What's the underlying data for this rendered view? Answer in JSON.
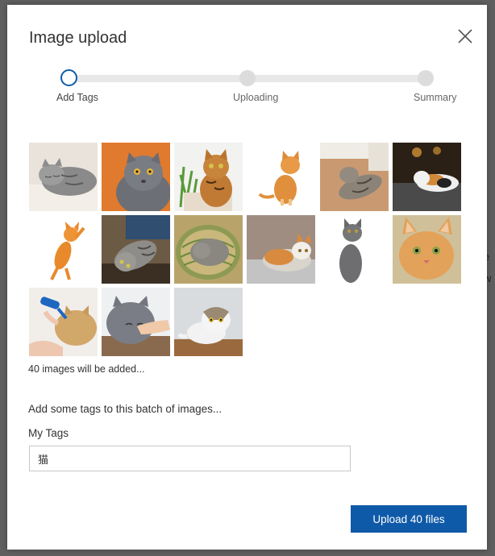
{
  "background_peek": {
    "line1": "e",
    "line2": "w"
  },
  "dialog": {
    "title": "Image upload",
    "steps": [
      {
        "label": "Add Tags",
        "state": "active"
      },
      {
        "label": "Uploading",
        "state": "pending"
      },
      {
        "label": "Summary",
        "state": "pending"
      }
    ],
    "thumbnails": [
      {
        "subject": "gray tabby cat sleeping on blanket"
      },
      {
        "subject": "gray British shorthair cat on orange background"
      },
      {
        "subject": "bengal cat beside potted plant"
      },
      {
        "subject": "orange kitten sitting, looking up"
      },
      {
        "subject": "tabby cat lying on wooden floor"
      },
      {
        "subject": "calico cat lying on gray rug"
      },
      {
        "subject": "orange kitten standing on hind legs"
      },
      {
        "subject": "tabby cat lying upside down"
      },
      {
        "subject": "gray cat curled in woven basket"
      },
      {
        "subject": "orange and white cat lying on gray sofa"
      },
      {
        "subject": "gray cat sitting, looking up"
      },
      {
        "subject": "orange kitten close-up portrait"
      },
      {
        "subject": "cat being brushed with blue grooming brush"
      },
      {
        "subject": "gray cat being petted by hand"
      },
      {
        "subject": "white and tabby cat on shelf"
      }
    ],
    "count_text": "40 images will be added...",
    "tags_prompt": "Add some tags to this batch of images...",
    "tags_label": "My Tags",
    "tags_value": "猫",
    "upload_button": "Upload 40 files"
  },
  "colors": {
    "accent": "#0f5aa8",
    "overlay": "#5f5f5f",
    "track": "#e8e8e8"
  }
}
